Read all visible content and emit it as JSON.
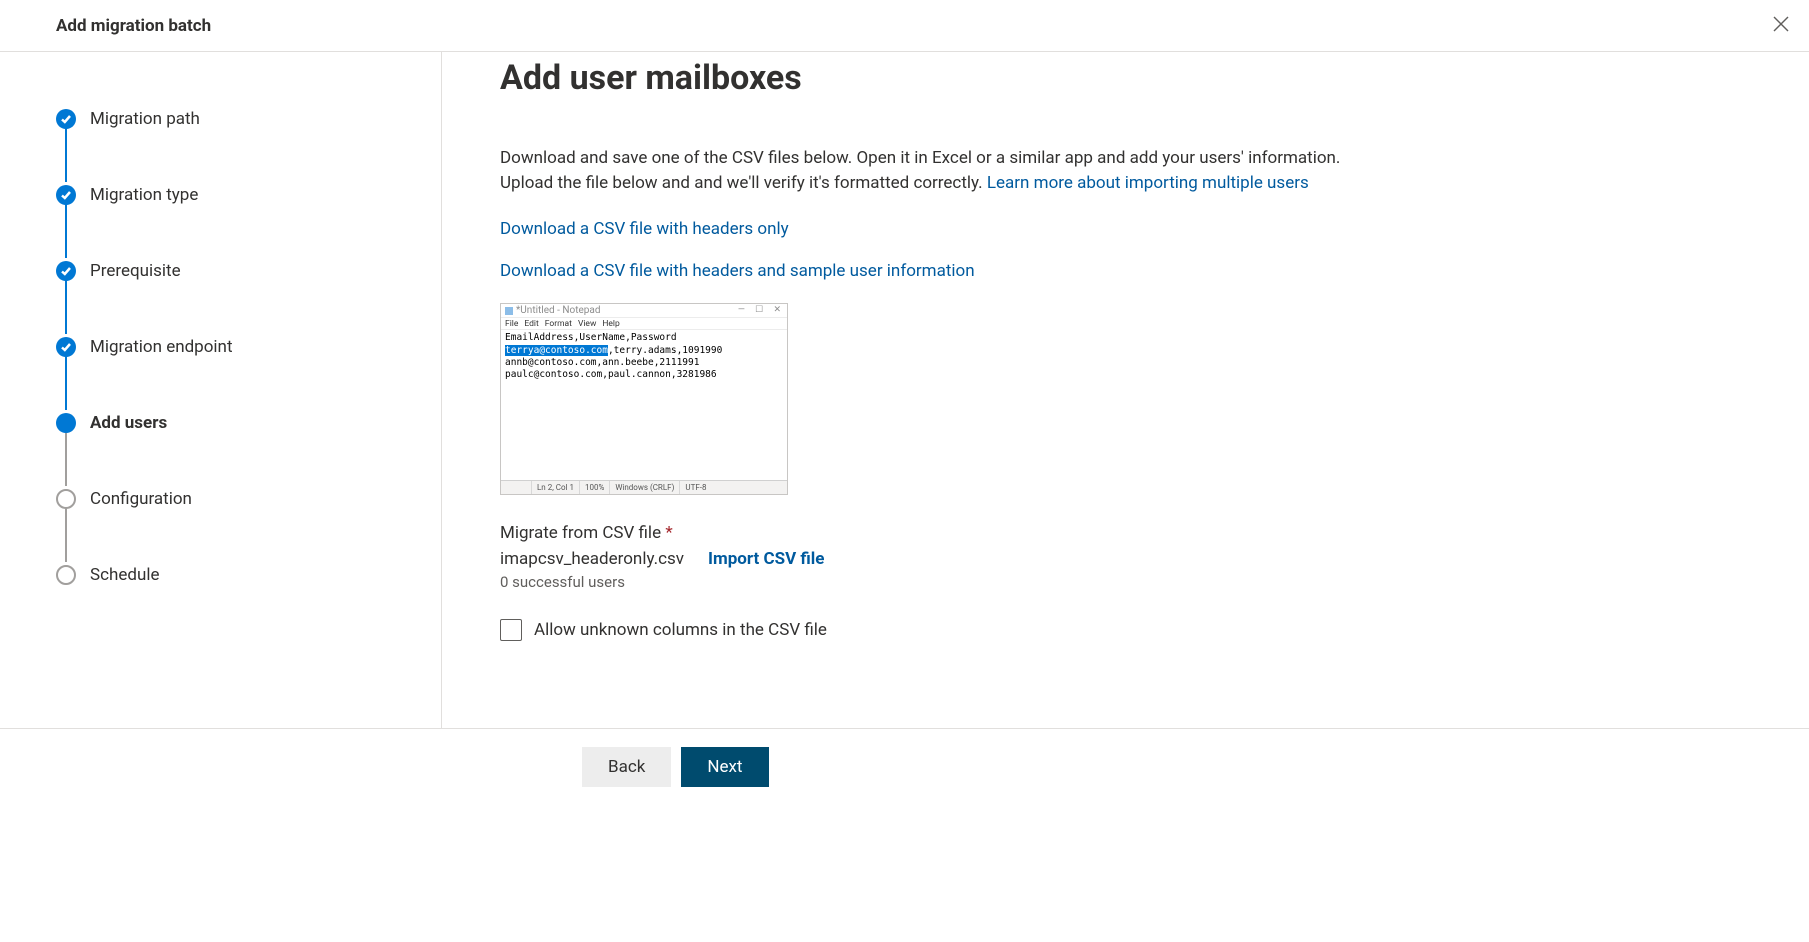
{
  "header": {
    "title": "Add migration batch"
  },
  "steps": [
    {
      "label": "Migration path",
      "state": "completed"
    },
    {
      "label": "Migration type",
      "state": "completed"
    },
    {
      "label": "Prerequisite",
      "state": "completed"
    },
    {
      "label": "Migration endpoint",
      "state": "completed"
    },
    {
      "label": "Add users",
      "state": "current"
    },
    {
      "label": "Configuration",
      "state": "pending"
    },
    {
      "label": "Schedule",
      "state": "pending"
    }
  ],
  "main": {
    "heading": "Add user mailboxes",
    "description_pre": "Download and save one of the CSV files below. Open it in Excel or a similar app and add your users' information. Upload the file below and and we'll verify it's formatted correctly. ",
    "description_link": "Learn more about importing multiple users",
    "download_link_1": "Download a CSV file with headers only",
    "download_link_2": "Download a CSV file with headers and sample user information",
    "notepad": {
      "title": "*Untitled - Notepad",
      "menu": [
        "File",
        "Edit",
        "Format",
        "View",
        "Help"
      ],
      "line1": "EmailAddress,UserName,Password",
      "line2_hl": "terrya@contoso.com",
      "line2_rest": ",terry.adams,1091990",
      "line3": "annb@contoso.com,ann.beebe,2111991",
      "line4": "paulc@contoso.com,paul.cannon,3281986",
      "status_ln": "Ln 2, Col 1",
      "status_zoom": "100%",
      "status_enc": "Windows (CRLF)",
      "status_utf": "UTF-8"
    },
    "field_label": "Migrate from CSV file",
    "file_name": "imapcsv_headeronly.csv",
    "import_link": "Import CSV file",
    "status_text": "0 successful users",
    "checkbox_label": "Allow unknown columns in the CSV file"
  },
  "footer": {
    "back": "Back",
    "next": "Next"
  }
}
